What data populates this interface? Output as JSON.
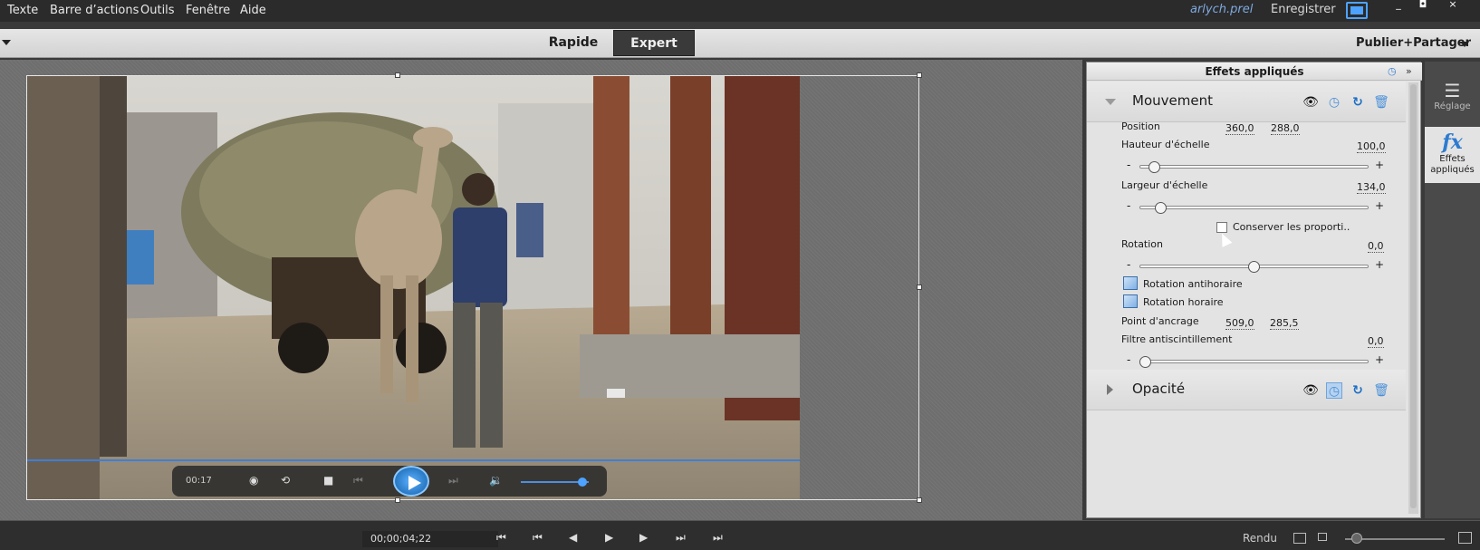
{
  "menubar": {
    "items": [
      "Texte",
      "Barre d’actions",
      "Outils",
      "Fenêtre",
      "Aide"
    ],
    "project_name": "arlych.prel",
    "save_label": "Enregistrer",
    "window_min": "_",
    "window_max": "◘",
    "window_close": "×"
  },
  "modebar": {
    "tabs": [
      {
        "label": "Rapide",
        "active": false
      },
      {
        "label": "Expert",
        "active": true
      }
    ],
    "publish_label": "Publier+Partager"
  },
  "player": {
    "time": "00:17",
    "icons": [
      "rewind-icon",
      "loop-icon",
      "stop-icon",
      "prev-icon",
      "play-icon",
      "next-icon",
      "volume-icon"
    ]
  },
  "panel": {
    "title": "Effets appliqués",
    "sections": [
      {
        "name": "Mouvement",
        "expanded": true,
        "properties": {
          "position": {
            "label": "Position",
            "x": "360,0",
            "y": "288,0"
          },
          "scale_height": {
            "label": "Hauteur d'échelle",
            "value": "100,0",
            "slider_fraction": 0.04
          },
          "scale_width": {
            "label": "Largeur d'échelle",
            "value": "134,0",
            "slider_fraction": 0.07
          },
          "keep_proportions": {
            "label": "Conserver les proporti..",
            "checked": false
          },
          "rotation": {
            "label": "Rotation",
            "value": "0,0",
            "slider_fraction": 0.5
          },
          "rotate_ccw": "Rotation antihoraire",
          "rotate_cw": "Rotation horaire",
          "anchor": {
            "label": "Point d'ancrage",
            "x": "509,0",
            "y": "285,5"
          },
          "antiflicker": {
            "label": "Filtre antiscintillement",
            "value": "0,0",
            "slider_fraction": 0.0
          }
        }
      },
      {
        "name": "Opacité",
        "expanded": false
      }
    ],
    "minus": "-",
    "plus": "+"
  },
  "toolstrip": {
    "adjust_label": "Réglage",
    "effects_label": "Effets appliqués",
    "fx_glyph": "fx"
  },
  "bottombar": {
    "timecode": "00;00;04;22",
    "render_label": "Rendu"
  },
  "colors": {
    "accent": "#4da3ff",
    "panel_bg": "#e3e3e3",
    "monitor_bg": "#6e6e6e"
  }
}
